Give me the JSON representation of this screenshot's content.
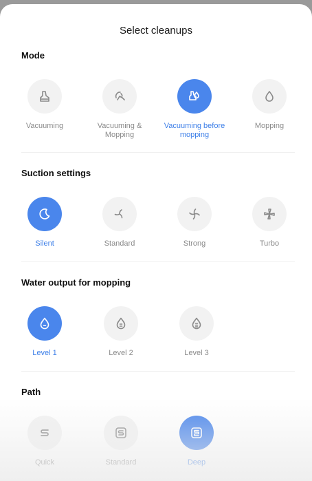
{
  "title": "Select cleanups",
  "colors": {
    "accent": "#4a86ec",
    "icon_gray": "#8a8a8a",
    "label_gray": "#8a8a8a"
  },
  "sections": {
    "mode": {
      "title": "Mode",
      "options": [
        {
          "label": "Vacuuming",
          "icon": "vacuum-icon"
        },
        {
          "label": "Vacuuming & Mopping",
          "icon": "vacuum-mop-icon"
        },
        {
          "label": "Vacuuming before mopping",
          "icon": "vacuum-then-mop-icon",
          "selected": true
        },
        {
          "label": "Mopping",
          "icon": "drop-icon"
        }
      ]
    },
    "suction": {
      "title": "Suction settings",
      "options": [
        {
          "label": "Silent",
          "icon": "moon-icon",
          "selected": true
        },
        {
          "label": "Standard",
          "icon": "fan-icon"
        },
        {
          "label": "Strong",
          "icon": "fan-strong-icon"
        },
        {
          "label": "Turbo",
          "icon": "fan-turbo-icon"
        }
      ]
    },
    "water": {
      "title": "Water output for mopping",
      "options": [
        {
          "label": "Level 1",
          "icon": "water-level-1-icon",
          "selected": true
        },
        {
          "label": "Level 2",
          "icon": "water-level-2-icon"
        },
        {
          "label": "Level 3",
          "icon": "water-level-3-icon"
        }
      ]
    },
    "path": {
      "title": "Path",
      "options": [
        {
          "label": "Quick",
          "icon": "path-quick-icon"
        },
        {
          "label": "Standard",
          "icon": "path-standard-icon"
        },
        {
          "label": "Deep",
          "icon": "path-deep-icon",
          "selected": true
        }
      ]
    }
  }
}
